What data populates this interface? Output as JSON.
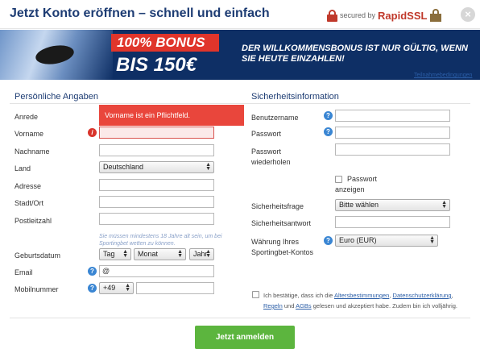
{
  "header": {
    "title": "Jetzt Konto eröffnen – schnell und einfach",
    "secured_by": "secured by",
    "ssl_brand": "RapidSSL",
    "close_glyph": "×"
  },
  "banner": {
    "bonus_line1": "100% BONUS",
    "bonus_line2": "BIS 150€",
    "message": "DER WILLKOMMENSBONUS IST NUR GÜLTIG, WENN SIE HEUTE EINZAHLEN!",
    "terms_link": "Teilnahmebedingungen"
  },
  "left": {
    "title": "Persönliche Angaben",
    "error_tooltip": "Vorname ist ein Pflichtfeld.",
    "labels": {
      "anrede": "Anrede",
      "vorname": "Vorname",
      "nachname": "Nachname",
      "land": "Land",
      "adresse": "Adresse",
      "stadt": "Stadt/Ort",
      "plz": "Postleitzahl",
      "geburtsdatum": "Geburtsdatum",
      "email": "Email",
      "mobil": "Mobilnummer"
    },
    "values": {
      "vorname": "",
      "nachname": "",
      "land": "Deutschland",
      "adresse": "",
      "stadt": "",
      "plz": "",
      "tag": "Tag",
      "monat": "Monat",
      "jahr": "Jahr",
      "email": "@",
      "vorwahl": "+49",
      "mobil": ""
    },
    "age_note": "Sie müssen mindestens 18 Jahre alt sein, um bei Sportingbet wetten zu können."
  },
  "right": {
    "title": "Sicherheitsinformation",
    "labels": {
      "benutzername": "Benutzername",
      "passwort": "Passwort",
      "passwort_wdh_1": "Passwort",
      "passwort_wdh_2": "wiederholen",
      "show_pw_1": "Passwort",
      "show_pw_2": "anzeigen",
      "frage": "Sicherheitsfrage",
      "antwort": "Sicherheitsantwort",
      "waehrung_1": "Währung Ihres",
      "waehrung_2": "Sportingbet-Kontos"
    },
    "values": {
      "frage": "Bitte wählen",
      "waehrung": "Euro (EUR)"
    }
  },
  "terms": {
    "pre": "Ich bestätige, dass ich die ",
    "link1": "Altersbestimmungen",
    "sep1": ", ",
    "link2": "Datenschutzerklärung",
    "sep2": ", ",
    "link3": "Regeln",
    "mid": " und ",
    "link4": "AGBs",
    "post": " gelesen und akzeptiert habe. Zudem bin ich volljährig."
  },
  "submit_label": "Jetzt anmelden",
  "colors": {
    "brand_blue": "#1d3c73",
    "error_red": "#e9463c",
    "submit_green": "#5cb53e",
    "help_blue": "#3a86d3"
  }
}
